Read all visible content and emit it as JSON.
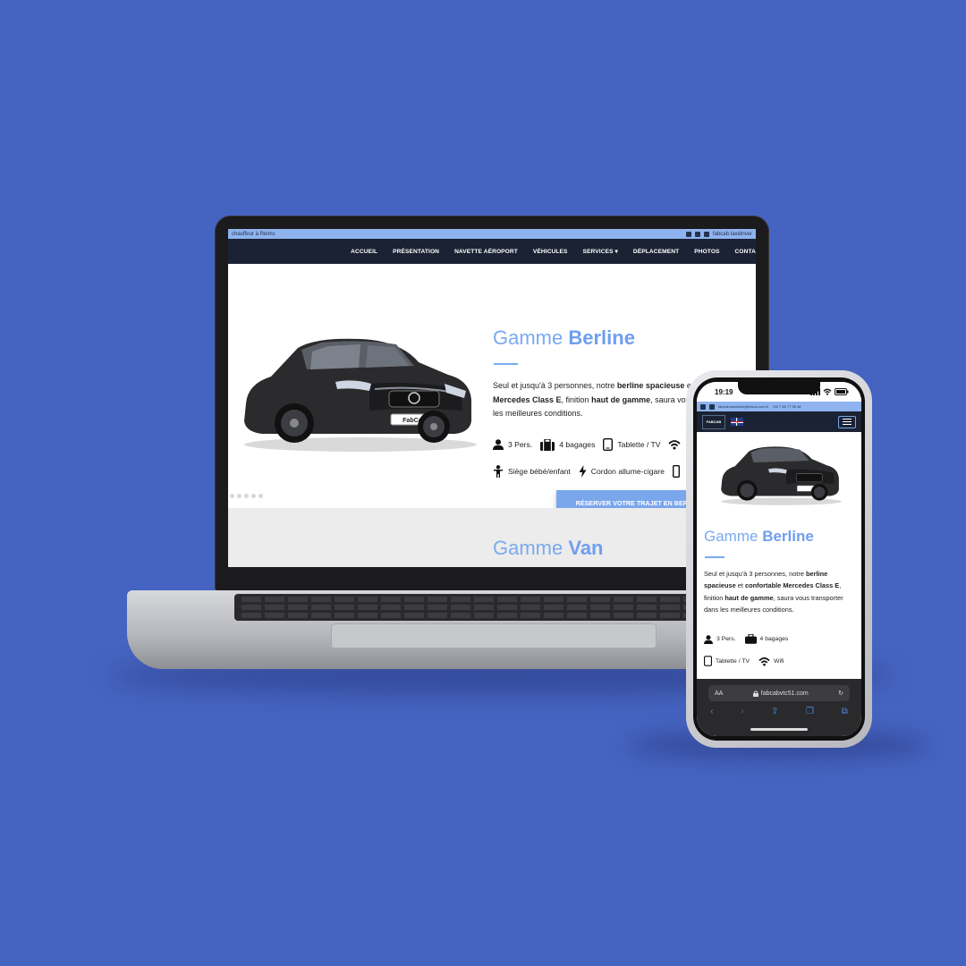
{
  "laptop": {
    "topbar": {
      "left": "chauffeur à Reims",
      "right": "fabcab.taxidriver"
    },
    "nav": [
      "ACCUEIL",
      "PRÉSENTATION",
      "NAVETTE AÉROPORT",
      "VÉHICULES",
      "SERVICES ▾",
      "DÉPLACEMENT",
      "PHOTOS",
      "CONTA"
    ],
    "title_light": "Gamme ",
    "title_bold": "Berline",
    "desc": {
      "p1": "Seul et jusqu'à 3 personnes, notre ",
      "b1": "berline spacieuse",
      "p2": " et ",
      "b2": "confortable Mercedes Class E",
      "p3": ", finition ",
      "b3": "haut de gamme",
      "p4": ", saura vous transporter dans les meilleures conditions."
    },
    "features": [
      "3 Pers.",
      "4 bagages",
      "Tablette / TV",
      "Siège bébé/enfant",
      "Cordon allume-cigare"
    ],
    "plate": "FabCab",
    "cta": "RÉSERVER VOTRE TRAJET EN BERLI",
    "section2_light": "Gamme ",
    "section2_bold": "Van"
  },
  "phone": {
    "time": "19:19",
    "topbar_email": "fabcab.taxidriver@icloud.com.fr",
    "topbar_phone": "+33 7 65 77 95 46",
    "logo": "FABCAB",
    "title_light": "Gamme ",
    "title_bold": "Berline",
    "desc": {
      "p1": "Seul et jusqu'à 3 personnes, notre ",
      "b1": "berline spacieuse",
      "p2": " et ",
      "b2": "confortable Mercedes Class E",
      "p3": ", finition ",
      "b3": "haut de gamme",
      "p4": ", saura vous transporter dans les meilleures conditions."
    },
    "features": [
      "3 Pers.",
      "4 bagages",
      "Tablette / TV",
      "Wifi"
    ],
    "url_aa": "AA",
    "url": "fabcabvtc51.com"
  },
  "colors": {
    "background": "#4563c1",
    "accent": "#7aaaf0",
    "navbar": "#1a2233"
  }
}
